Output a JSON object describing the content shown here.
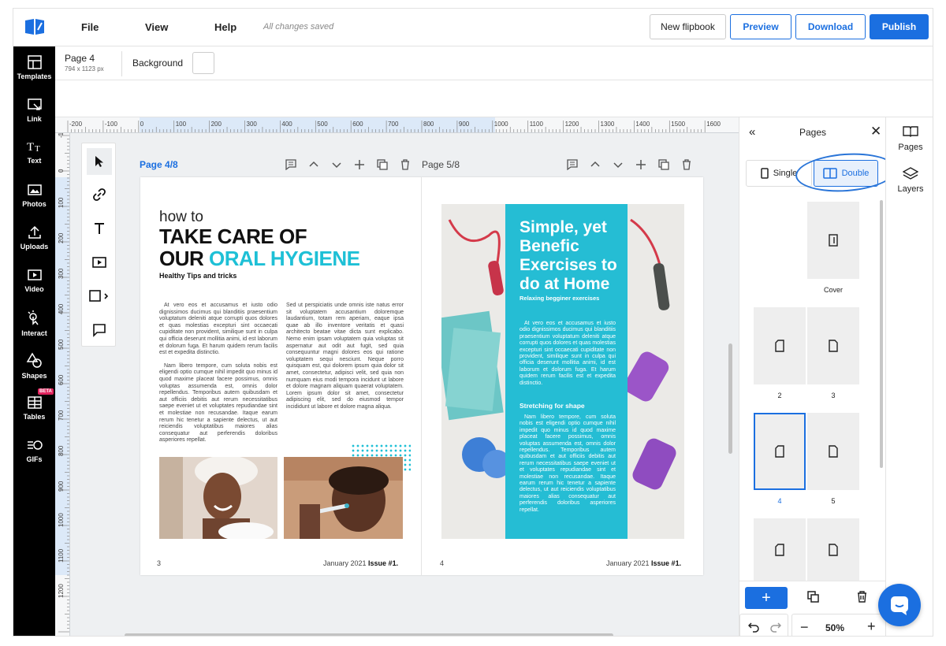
{
  "topbar": {
    "menu": [
      "File",
      "View",
      "Help"
    ],
    "status": "All changes saved",
    "buttons": {
      "new": "New flipbook",
      "preview": "Preview",
      "download": "Download",
      "publish": "Publish"
    }
  },
  "sidebar": {
    "items": [
      {
        "label": "Templates",
        "icon": "templates-icon"
      },
      {
        "label": "Link",
        "icon": "link-icon"
      },
      {
        "label": "Text",
        "icon": "text-icon"
      },
      {
        "label": "Photos",
        "icon": "photos-icon"
      },
      {
        "label": "Uploads",
        "icon": "uploads-icon"
      },
      {
        "label": "Video",
        "icon": "video-icon"
      },
      {
        "label": "Interact",
        "icon": "interact-icon"
      },
      {
        "label": "Shapes",
        "icon": "shapes-icon"
      },
      {
        "label": "Tables",
        "icon": "tables-icon",
        "badge": "BETA"
      },
      {
        "label": "GIFs",
        "icon": "gifs-icon"
      }
    ]
  },
  "propbar": {
    "page": "Page 4",
    "size": "794 x 1123 px",
    "background_label": "Background",
    "background_color": "#ffffff"
  },
  "ruler": {
    "h": [
      "-200",
      "-100",
      "0",
      "100",
      "200",
      "300",
      "400",
      "500",
      "600",
      "700",
      "800",
      "900",
      "1000",
      "1100",
      "1200",
      "1300",
      "1400",
      "1500",
      "1600"
    ],
    "v": [
      "-1",
      "0",
      "100",
      "200",
      "300",
      "400",
      "500",
      "600",
      "700",
      "800",
      "900",
      "1000",
      "1100",
      "1200"
    ]
  },
  "canvas": {
    "left_page_label": "Page 4/8",
    "right_page_label": "Page 5/8",
    "left_page": {
      "howto": "how to",
      "headline1": "TAKE CARE OF",
      "headline2_a": "OUR ",
      "headline2_b": "ORAL HYGIENE",
      "subhead": "Healthy Tips and tricks",
      "col1_p1": "At vero eos et accusamus et iusto odio dignissimos ducimus qui blanditiis praesentium voluptatum deleniti atque corrupti quos dolores et quas molestias excepturi sint occaecati cupiditate non provident, similique sunt in culpa qui officia deserunt mollitia animi, id est laborum et dolorum fuga. Et harum quidem rerum facilis est et expedita distinctio.",
      "col1_p2": "Nam libero tempore, cum soluta nobis est eligendi optio cumque nihil impedit quo minus id quod maxime placeat facere possimus, omnis voluptas assumenda est, omnis dolor repellendus. Temporibus autem quibusdam et aut officiis debitis aut rerum necessitatibus saepe eveniet ut et voluptates repudiandae sint et molestiae non recusandae. Itaque earum rerum hic tenetur a sapiente delectus, ut aut reiciendis voluptatibus maiores alias consequatur aut perferendis doloribus asperiores repellat.",
      "col2": "Sed ut perspiciatis unde omnis iste natus error sit voluptatem accusantium doloremque laudantium, totam rem aperiam, eaque ipsa quae ab illo inventore veritatis et quasi architecto beatae vitae dicta sunt explicabo. Nemo enim ipsam voluptatem quia voluptas sit aspernatur aut odit aut fugit, sed quia consequuntur magni dolores eos qui ratione voluptatem sequi nesciunt. Neque porro quisquam est, qui dolorem ipsum quia dolor sit amet, consectetur, adipisci velit, sed quia non numquam eius modi tempora incidunt ut labore et dolore magnam aliquam quaerat voluptatem. Lorem ipsum dolor sit amet, consectetur adipiscing elit, sed do eiusmod tempor incididunt ut labore et dolore magna aliqua.",
      "page_num": "3",
      "footer_date": "January 2021 ",
      "footer_issue": "Issue #1."
    },
    "right_page": {
      "title": "Simple, yet Benefic Exercises to do at Home",
      "subtitle": "Relaxing begginer exercises",
      "body1": "At vero eos et accusamus et iusto odio dignissimos ducimus qui blanditiis praesentium voluptatum deleniti atque corrupti quos dolores et quas molestias excepturi sint occaecati cupiditate non provident, similique sunt in culpa qui officia deserunt mollitia animi, id est laborum et dolorum fuga. Et harum quidem rerum facilis est et expedita distinctio.",
      "heading2": "Stretching for shape",
      "body2": "Nam libero tempore, cum soluta nobis est eligendi optio cumque nihil impedit quo minus id quod maxime placeat facere possimus, omnis voluptas assumenda est, omnis dolor repellendus. Temporibus autem quibusdam et aut officiis debitis aut rerum necessitatibus saepe eveniet ut et voluptates repudiandae sint et molestiae non recusandae. Itaque earum rerum hic tenetur a sapiente delectus, ut aut reiciendis voluptatibus maiores alias consequatur aut perferendis doloribus asperiores repellat.",
      "page_num": "4",
      "footer_date": "January 2021 ",
      "footer_issue": "Issue #1."
    }
  },
  "pages_panel": {
    "title": "Pages",
    "mode_single": "Single",
    "mode_double": "Double",
    "thumbs": [
      {
        "label": "Cover"
      },
      {
        "label": "2"
      },
      {
        "label": "3"
      },
      {
        "label": "4",
        "selected": true
      },
      {
        "label": "5"
      }
    ],
    "zoom": "50%"
  },
  "right_tabs": {
    "pages": "Pages",
    "layers": "Layers"
  },
  "colors": {
    "accent": "#1b6fe0",
    "teal": "#1ec0d6",
    "sidebar": "#000000"
  }
}
